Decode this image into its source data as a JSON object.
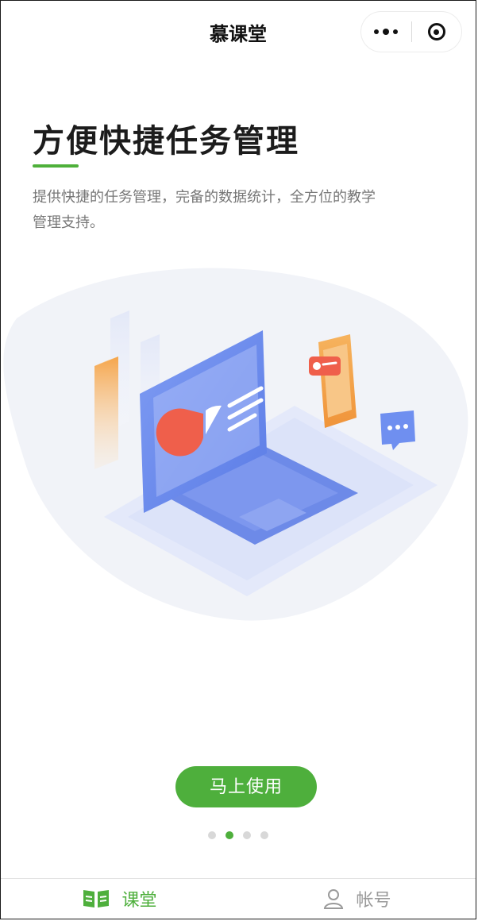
{
  "nav": {
    "title": "慕课堂",
    "more_icon": "more-dots-icon",
    "close_icon": "target-icon"
  },
  "onboarding": {
    "headline": "方便快捷任务管理",
    "description": "提供快捷的任务管理，完备的数据统计，全方位的教学管理支持。",
    "cta_label": "马上使用",
    "pager": {
      "total": 4,
      "active_index": 1
    }
  },
  "tabbar": {
    "items": [
      {
        "label": "课堂",
        "icon": "book-icon",
        "active": true
      },
      {
        "label": "帐号",
        "icon": "user-icon",
        "active": false
      }
    ]
  },
  "colors": {
    "accent": "#4eaf3c",
    "illustration_blue": "#6f8ff0",
    "illustration_orange": "#f5a54b"
  }
}
